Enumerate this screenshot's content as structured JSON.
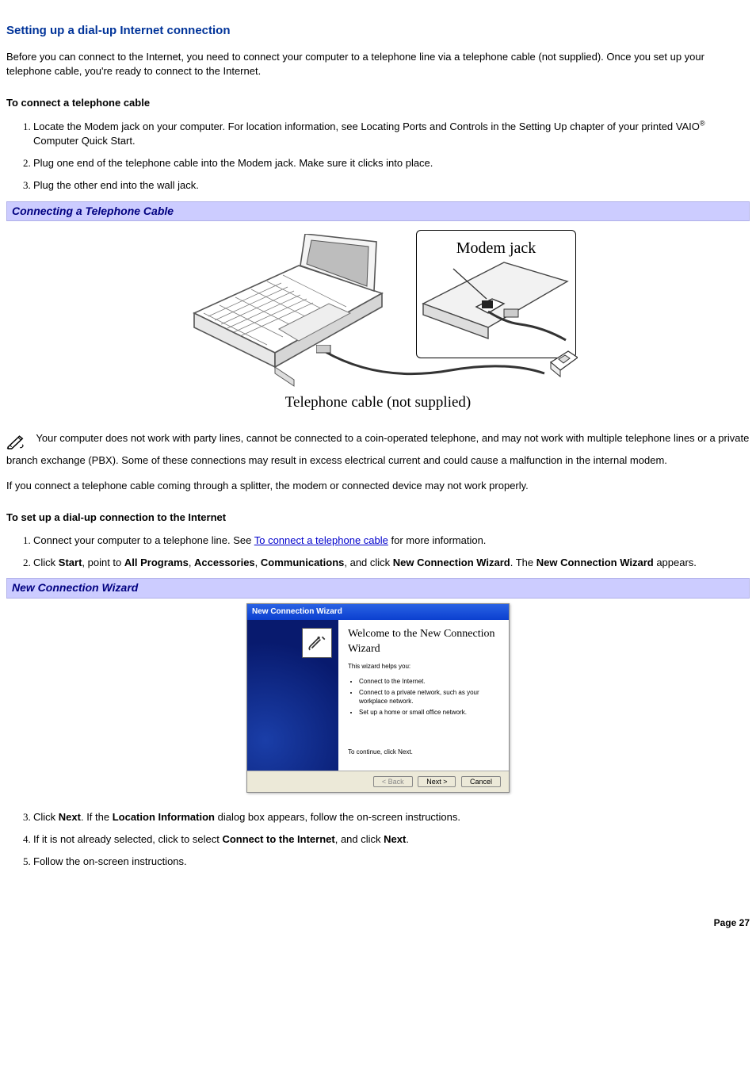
{
  "title": "Setting up a dial-up Internet connection",
  "intro": "Before you can connect to the Internet, you need to connect your computer to a telephone line via a telephone cable (not supplied). Once you set up your telephone cable, you're ready to connect to the Internet.",
  "connect_cable": {
    "heading": "To connect a telephone cable",
    "steps": {
      "s1a": "Locate the Modem jack on your computer. For location information, see Locating Ports and Controls in the Setting Up chapter of your printed VAIO",
      "s1b": " Computer Quick Start.",
      "reg": "®",
      "s2": "Plug one end of the telephone cable into the Modem jack. Make sure it clicks into place.",
      "s3": "Plug the other end into the wall jack."
    }
  },
  "banner1": "Connecting a Telephone Cable",
  "fig1": {
    "modem_label": "Modem jack",
    "caption": "Telephone cable (not supplied)"
  },
  "note1": "Your computer does not work with party lines, cannot be connected to a coin-operated telephone, and may not work with multiple telephone lines or a private branch exchange (PBX). Some of these connections may result in excess electrical current and could cause a malfunction in the internal modem.",
  "para_splitter": "If you connect a telephone cable coming through a splitter, the modem or connected device may not work properly.",
  "dialup": {
    "heading": "To set up a dial-up connection to the Internet",
    "s1_pre": "Connect your computer to a telephone line. See ",
    "s1_link": "To connect a telephone cable",
    "s1_post": " for more information.",
    "s2_pre": "Click ",
    "s2_b1": "Start",
    "s2_m1": ", point to ",
    "s2_b2": "All Programs",
    "s2_m2": ", ",
    "s2_b3": "Accessories",
    "s2_m3": ", ",
    "s2_b4": "Communications",
    "s2_m4": ", and click ",
    "s2_b5": "New Connection Wizard",
    "s2_m5": ". The ",
    "s2_b6": "New Connection Wizard",
    "s2_m6": " appears."
  },
  "banner2": "New Connection Wizard",
  "wizard": {
    "title": "New Connection Wizard",
    "heading": "Welcome to the New Connection Wizard",
    "helps": "This wizard helps you:",
    "b1": "Connect to the Internet.",
    "b2": "Connect to a private network, such as your workplace network.",
    "b3": "Set up a home or small office network.",
    "continue": "To continue, click Next.",
    "back": "< Back",
    "next": "Next >",
    "cancel": "Cancel"
  },
  "after": {
    "s3_pre": "Click ",
    "s3_b1": "Next",
    "s3_m1": ". If the ",
    "s3_b2": "Location Information",
    "s3_m2": " dialog box appears, follow the on-screen instructions.",
    "s4_pre": "If it is not already selected, click to select ",
    "s4_b1": "Connect to the Internet",
    "s4_m1": ", and click ",
    "s4_b2": "Next",
    "s4_m2": ".",
    "s5": "Follow the on-screen instructions."
  },
  "page_num": "Page 27"
}
